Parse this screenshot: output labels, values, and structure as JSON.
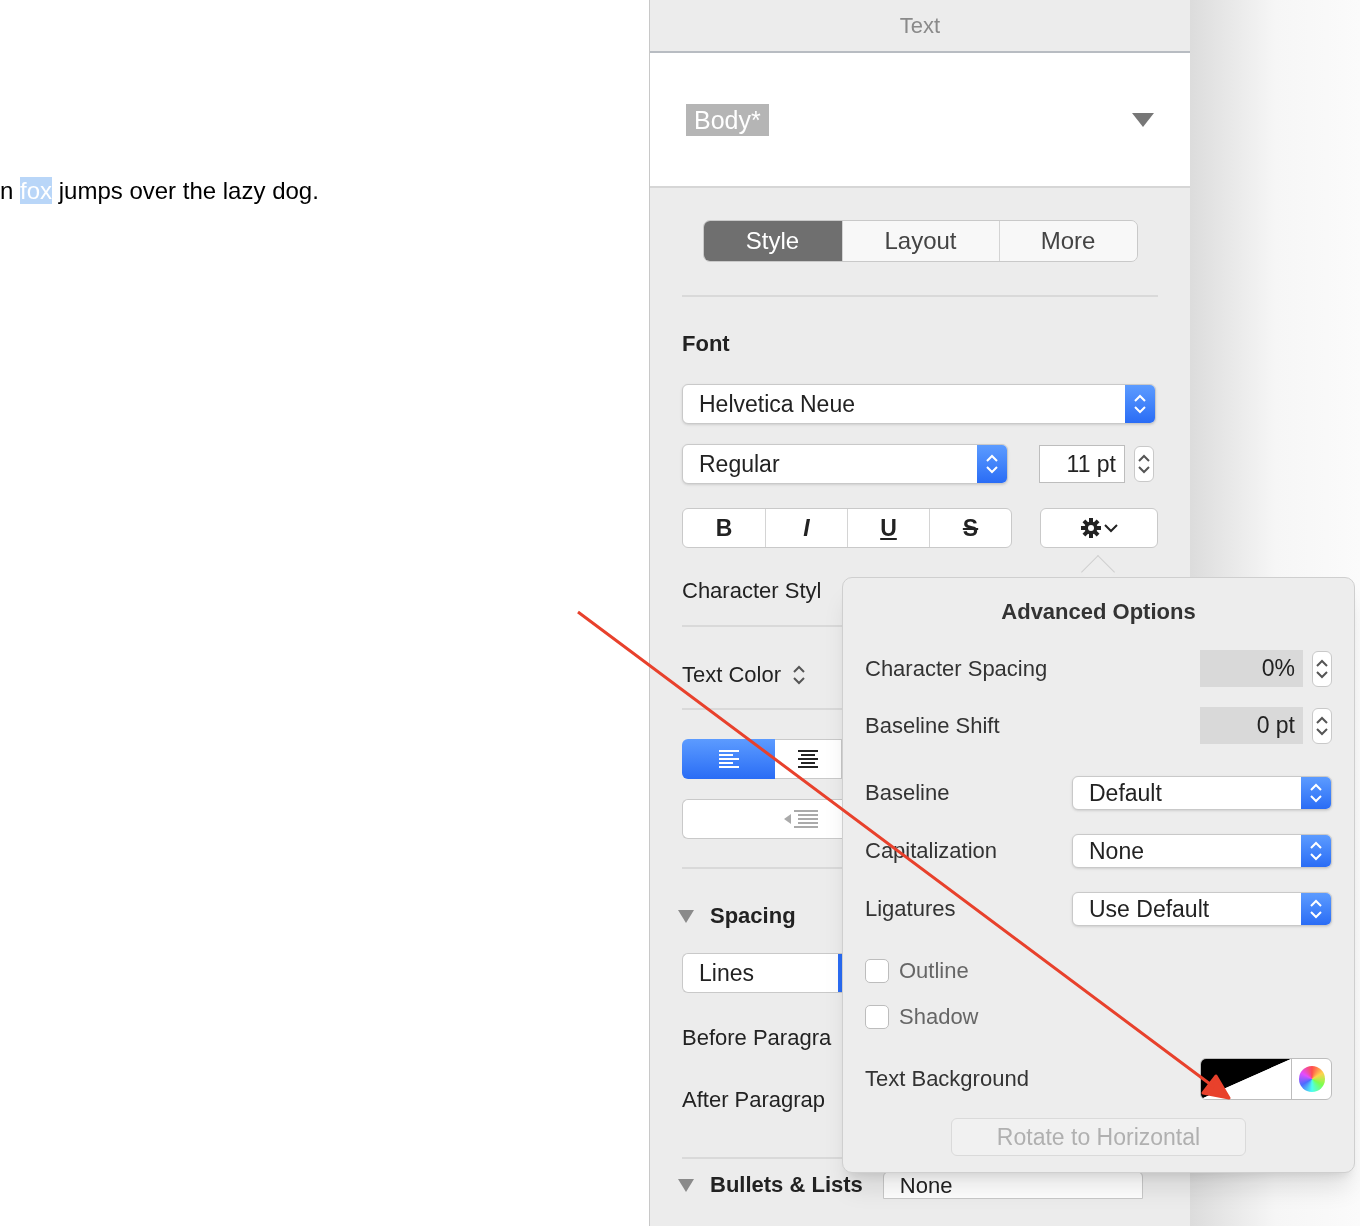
{
  "document": {
    "text_before": "n",
    "selected_text": "fox",
    "text_after": " jumps over the lazy dog."
  },
  "panel": {
    "title": "Text",
    "paragraph_style": "Body*",
    "tabs": [
      {
        "label": "Style",
        "selected": true
      },
      {
        "label": "Layout",
        "selected": false
      },
      {
        "label": "More",
        "selected": false
      }
    ],
    "font": {
      "heading": "Font",
      "family": "Helvetica Neue",
      "typeface": "Regular",
      "size": "11 pt",
      "format_buttons": [
        {
          "label": "B",
          "kind": "bold"
        },
        {
          "label": "I",
          "kind": "italic"
        },
        {
          "label": "U",
          "kind": "underline"
        },
        {
          "label": "S",
          "kind": "strikethrough"
        }
      ]
    },
    "character_style_label": "Character Styl",
    "text_color_label": "Text Color",
    "alignment": [
      {
        "kind": "left",
        "selected": true
      },
      {
        "kind": "center",
        "selected": false
      }
    ],
    "spacing": {
      "heading": "Spacing",
      "expanded": true,
      "lines": "Lines",
      "before_label": "Before Paragra",
      "after_label": "After Paragrap"
    },
    "bullets": {
      "heading": "Bullets & Lists",
      "expanded": true,
      "value": "None"
    }
  },
  "advanced_options": {
    "title": "Advanced Options",
    "steppers": [
      {
        "label": "Character Spacing",
        "value": "0%"
      },
      {
        "label": "Baseline Shift",
        "value": "0 pt"
      }
    ],
    "popups": [
      {
        "label": "Baseline",
        "value": "Default"
      },
      {
        "label": "Capitalization",
        "value": "None"
      },
      {
        "label": "Ligatures",
        "value": "Use Default"
      }
    ],
    "checkboxes": [
      {
        "label": "Outline",
        "checked": false
      },
      {
        "label": "Shadow",
        "checked": false
      }
    ],
    "text_background": {
      "label": "Text Background"
    },
    "rotate_button": {
      "label": "Rotate to Horizontal",
      "disabled": true
    }
  }
}
